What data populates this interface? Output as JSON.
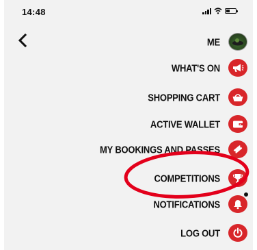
{
  "status_bar": {
    "time": "14:48"
  },
  "menu": {
    "items": [
      {
        "id": "me",
        "label": "ME",
        "icon": "avatar-icon"
      },
      {
        "id": "whats-on",
        "label": "WHAT'S ON",
        "icon": "megaphone-icon"
      },
      {
        "id": "shopping-cart",
        "label": "SHOPPING CART",
        "icon": "shopping-basket-icon"
      },
      {
        "id": "active-wallet",
        "label": "ACTIVE WALLET",
        "icon": "wallet-icon"
      },
      {
        "id": "my-bookings",
        "label": "MY BOOKINGS AND PASSES",
        "icon": "ticket-icon"
      },
      {
        "id": "competitions",
        "label": "COMPETITIONS",
        "icon": "trophy-icon"
      },
      {
        "id": "notifications",
        "label": "NOTIFICATIONS",
        "icon": "bell-icon"
      },
      {
        "id": "log-out",
        "label": "LOG OUT",
        "icon": "power-icon"
      }
    ]
  },
  "colors": {
    "accent": "#d8262a",
    "highlight": "#e3001b",
    "background": "#f2f2f2"
  }
}
